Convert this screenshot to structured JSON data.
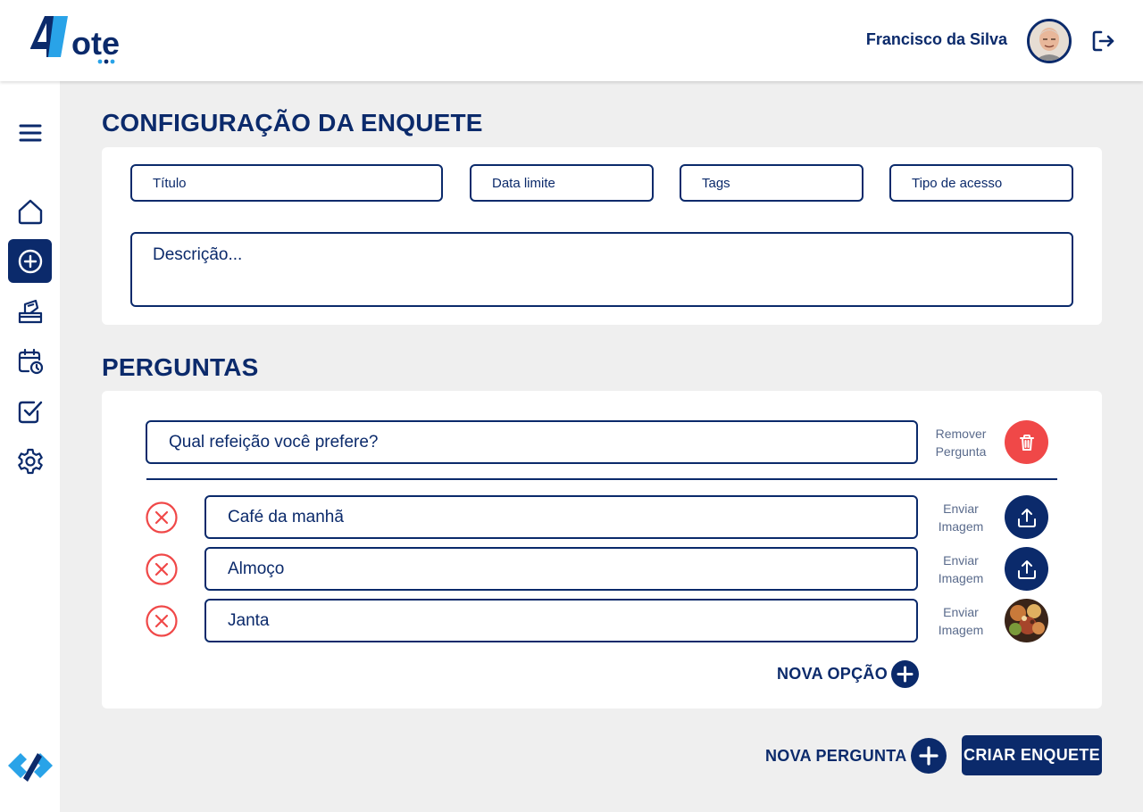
{
  "header": {
    "logo_text": "4Vote",
    "user_name": "Francisco da Silva",
    "avatar_icon": "user-avatar",
    "logout_icon": "logout-icon"
  },
  "sidebar": {
    "items": [
      {
        "name": "menu",
        "icon": "hamburger-icon",
        "active": false
      },
      {
        "name": "home",
        "icon": "home-icon",
        "active": false
      },
      {
        "name": "create",
        "icon": "plus-circle-icon",
        "active": true
      },
      {
        "name": "votes",
        "icon": "ballot-box-icon",
        "active": false
      },
      {
        "name": "schedule",
        "icon": "calendar-clock-icon",
        "active": false
      },
      {
        "name": "completed",
        "icon": "checkbox-icon",
        "active": false
      },
      {
        "name": "settings",
        "icon": "gear-icon",
        "active": false
      }
    ]
  },
  "config": {
    "title": "CONFIGURAÇÃO DA ENQUETE",
    "titulo_placeholder": "Título",
    "data_limite_placeholder": "Data limite",
    "tags_placeholder": "Tags",
    "tipo_acesso_placeholder": "Tipo de acesso",
    "descricao_placeholder": "Descrição..."
  },
  "questions": {
    "title": "PERGUNTAS",
    "question_value": "Qual refeição você prefere?",
    "remove_label_1": "Remover",
    "remove_label_2": "Pergunta",
    "options": [
      {
        "value": "Café da manhã",
        "label_1": "Enviar",
        "label_2": "Imagem",
        "has_image": false
      },
      {
        "value": "Almoço",
        "label_1": "Enviar",
        "label_2": "Imagem",
        "has_image": false
      },
      {
        "value": "Janta",
        "label_1": "Enviar",
        "label_2": "Imagem",
        "has_image": true
      }
    ],
    "new_option_label": "NOVA OPÇÃO"
  },
  "footer": {
    "new_question_label": "NOVA PERGUNTA",
    "create_poll_label": "CRIAR ENQUETE"
  },
  "colors": {
    "primary": "#0b2a6b",
    "accent_blue": "#29a3e8",
    "danger": "#f04848",
    "background": "#efefef"
  }
}
